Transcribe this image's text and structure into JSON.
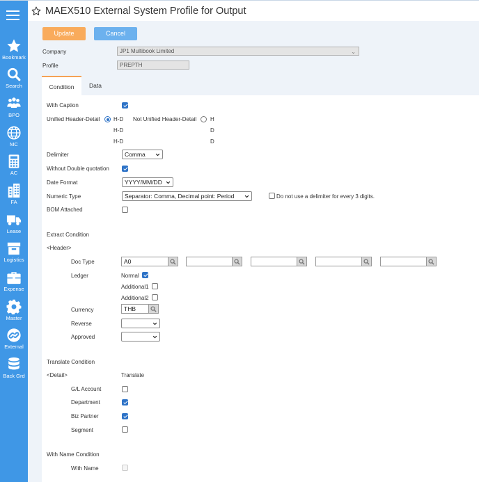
{
  "window": {
    "title": "MAEX510 External System Profile for Output"
  },
  "sidebar": {
    "items": [
      {
        "label": "Bookmark",
        "icon": "star-icon"
      },
      {
        "label": "Search",
        "icon": "magnifier-icon"
      },
      {
        "label": "BPO",
        "icon": "people-icon"
      },
      {
        "label": "MC",
        "icon": "globe-icon"
      },
      {
        "label": "AC",
        "icon": "calculator-icon"
      },
      {
        "label": "FA",
        "icon": "building-icon"
      },
      {
        "label": "Lease",
        "icon": "truck-icon"
      },
      {
        "label": "Logistics",
        "icon": "box-icon"
      },
      {
        "label": "Expense",
        "icon": "briefcase-icon"
      },
      {
        "label": "Master",
        "icon": "gear-icon"
      },
      {
        "label": "External",
        "icon": "link-icon"
      },
      {
        "label": "Back Grd",
        "icon": "database-icon"
      }
    ]
  },
  "toolbar": {
    "update_label": "Update",
    "cancel_label": "Cancel"
  },
  "header_fields": {
    "company_label": "Company",
    "company_value": "JP1 Multibook Limited",
    "profile_label": "Profile",
    "profile_value": "PREPTH"
  },
  "tabs": [
    {
      "label": "Condition",
      "active": true
    },
    {
      "label": "Data",
      "active": false
    }
  ],
  "condition": {
    "with_caption": {
      "label": "With Caption",
      "checked": true
    },
    "unified": {
      "label": "Unified Header-Detail",
      "selected": true,
      "lines": [
        "H-D",
        "H-D",
        "H-D"
      ]
    },
    "not_unified": {
      "label": "Not Unified Header-Detail",
      "selected": false,
      "lines": [
        "H",
        "D",
        "D"
      ]
    },
    "delimiter": {
      "label": "Delimiter",
      "value": "Comma"
    },
    "without_double_quotation": {
      "label": "Without Double quotation",
      "checked": true
    },
    "date_format": {
      "label": "Date Format",
      "value": "YYYY/MM/DD"
    },
    "numeric_type": {
      "label": "Numeric Type",
      "value": "Separator: Comma, Decimal point: Period",
      "no_delimiter_label": "Do not use a delimiter for every 3 digits.",
      "no_delimiter_checked": false
    },
    "bom_attached": {
      "label": "BOM Attached",
      "checked": false
    }
  },
  "extract": {
    "section_label": "Extract Condition",
    "header_label": "<Header>",
    "doc_type": {
      "label": "Doc Type",
      "values": [
        "A0",
        "",
        "",
        "",
        ""
      ]
    },
    "ledger": {
      "label": "Ledger",
      "options": [
        {
          "label": "Normal",
          "checked": true
        },
        {
          "label": "Additional1",
          "checked": false
        },
        {
          "label": "Additional2",
          "checked": false
        }
      ]
    },
    "currency": {
      "label": "Currency",
      "value": "THB"
    },
    "reverse": {
      "label": "Reverse",
      "value": ""
    },
    "approved": {
      "label": "Approved",
      "value": ""
    }
  },
  "translate": {
    "section_label": "Translate Condition",
    "detail_label": "<Detail>",
    "translate_header": "Translate",
    "items": [
      {
        "label": "G/L Account",
        "checked": false
      },
      {
        "label": "Department",
        "checked": true
      },
      {
        "label": "Biz Partner",
        "checked": true
      },
      {
        "label": "Segment",
        "checked": false
      }
    ]
  },
  "with_name": {
    "section_label": "With Name Condition",
    "with_name": {
      "label": "With Name",
      "checked": false
    }
  },
  "colors": {
    "sidebar": "#3f97e6",
    "update": "#f9ab5c",
    "cancel": "#6cb1ee",
    "accent": "#2e73c7",
    "main_bg": "#eef3f9"
  }
}
